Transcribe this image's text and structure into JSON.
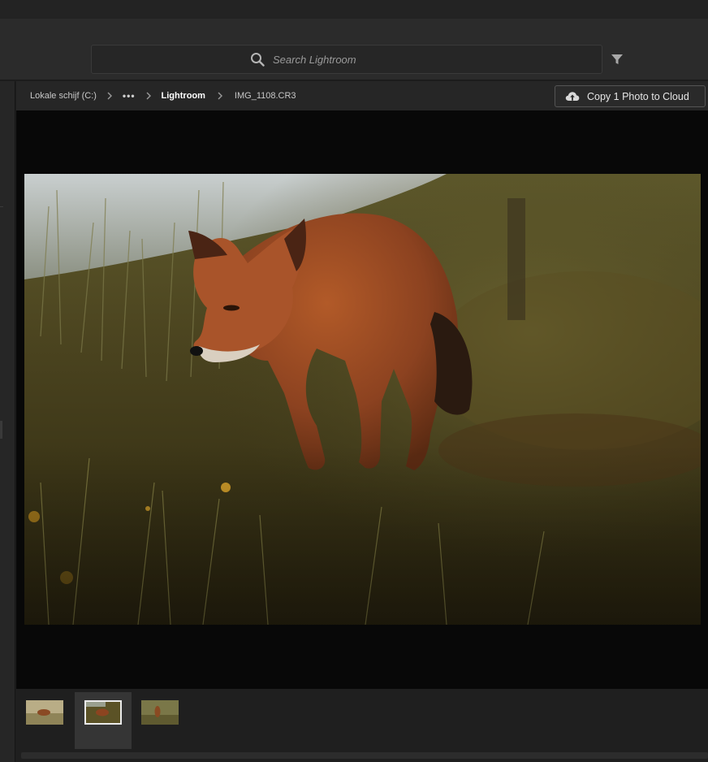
{
  "search": {
    "placeholder": "Search Lightroom"
  },
  "breadcrumb": {
    "items": [
      "Lokale schijf (C:)",
      "•••",
      "Lightroom",
      "IMG_1108.CR3"
    ]
  },
  "actions": {
    "copy_to_cloud": "Copy 1 Photo to Cloud"
  },
  "filmstrip": {
    "count": 3,
    "selected_index": 1
  },
  "colors": {
    "accent": "#ffffff",
    "background": "#1e1e1e",
    "viewer": "#080808"
  }
}
